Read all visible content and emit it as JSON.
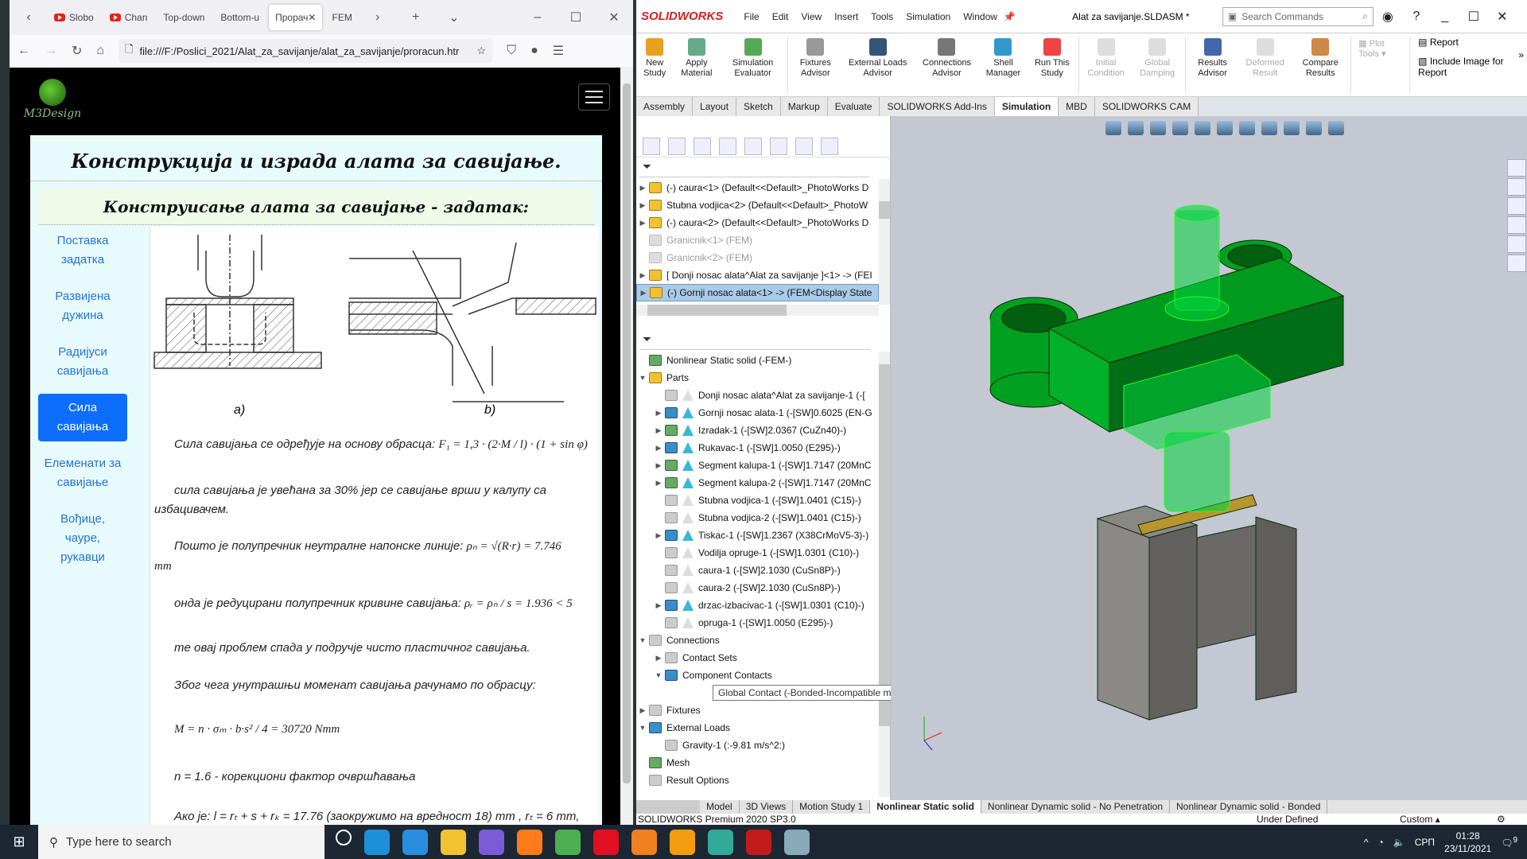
{
  "browser": {
    "tabs": [
      {
        "label": "Slobo",
        "icon": "youtube"
      },
      {
        "label": "Chan",
        "icon": "youtube"
      },
      {
        "label": "Top-down"
      },
      {
        "label": "Bottom-u"
      },
      {
        "label": "Прорач",
        "active": true
      },
      {
        "label": "FEM"
      }
    ],
    "url": "file:///F:/Poslici_2021/Alat_za_savijanje/alat_za_savijanje/proracun.htr",
    "site_logo": "M3Design",
    "page": {
      "title": "Конструкција и израда алата за савијање.",
      "subtitle": "Конструисање алата за савијање - задатак:",
      "nav": [
        "Поставка задатка",
        "Развијена дужина",
        "Радијуси савијања",
        "Сила савијања",
        "Елеменати за савијање",
        "Вођице, чауре, рукавци"
      ],
      "active_nav": 3,
      "figure_labels": {
        "a": "a)",
        "b": "b)"
      },
      "paragraphs": {
        "p1": "Сила савијања се одређује на основу обрасца:",
        "f1": "F₁ = 1,3 · (2·M / l) · (1 + sin φ)",
        "p2": "сила савијања је увећана за 30% јер се савијање врши у калупу са избацивачем.",
        "p3": "Пошто је полупречник неутралне напонске линије:",
        "f3": "ρₙ = √(R·r) =  7.746",
        "f3unit": "mm",
        "p4": "онда је редуцирани полупречник кривине савијања:",
        "f4": "ρᵣ = ρₙ / s =  1.936 < 5",
        "p5": "те овај проблем спада у подручје чисто пластичног савијања.",
        "p6": "Због чега унутрашњи моменат савијања рачунамо по обрасцу:",
        "f6": "M = n · σₘ · b·s² / 4 =  30720  Nmm",
        "p7": "n =  1.6 - корекциони фактор очвршћавања",
        "p8": "Ако је: l = rₜ + s + rₖ =  17.76 (заокружимо на вредност 18) mm , rₜ =  6 mm,"
      }
    }
  },
  "solidworks": {
    "brand": "SOLIDWORKS",
    "menu": [
      "File",
      "Edit",
      "View",
      "Insert",
      "Tools",
      "Simulation",
      "Window"
    ],
    "doc_title": "Alat za savijanje.SLDASM *",
    "search_placeholder": "Search Commands",
    "ribbon": [
      {
        "label": "New Study",
        "color": "#e8a020"
      },
      {
        "label": "Apply Material",
        "color": "#6a8"
      },
      {
        "label": "Simulation Evaluator",
        "color": "#5a5"
      },
      {
        "label": "Fixtures Advisor",
        "color": "#999"
      },
      {
        "label": "External Loads Advisor",
        "color": "#357"
      },
      {
        "label": "Connections Advisor",
        "color": "#777"
      },
      {
        "label": "Shell Manager",
        "color": "#39c"
      },
      {
        "label": "Run This Study",
        "color": "#e44"
      },
      {
        "label": "Initial Condition",
        "disabled": true
      },
      {
        "label": "Global Damping",
        "disabled": true
      },
      {
        "label": "Results Advisor",
        "color": "#46a"
      },
      {
        "label": "Deformed Result",
        "disabled": true
      },
      {
        "label": "Compare Results",
        "color": "#c84"
      }
    ],
    "ribbon_right": {
      "plot_tools": "Plot Tools",
      "report": "Report",
      "include_image": "Include Image for Report"
    },
    "command_tabs": [
      "Assembly",
      "Layout",
      "Sketch",
      "Markup",
      "Evaluate",
      "SOLIDWORKS Add-Ins",
      "Simulation",
      "MBD",
      "SOLIDWORKS CAM"
    ],
    "active_command_tab": "Simulation",
    "feature_tree": [
      {
        "label": "(-) caura<1> (Default<<Default>_PhotoWorks D"
      },
      {
        "label": "Stubna vodjica<2> (Default<<Default>_PhotoW"
      },
      {
        "label": "(-) caura<2> (Default<<Default>_PhotoWorks D"
      },
      {
        "label": "Granicnik<1> (FEM)",
        "dim": true
      },
      {
        "label": "Granicnik<2> (FEM)",
        "dim": true
      },
      {
        "label": "[ Donji nosac alata^Alat za savijanje ]<1> -> (FEI"
      },
      {
        "label": "(-) Gornji nosac alata<1> -> (FEM<Display State",
        "selected": true
      }
    ],
    "study": {
      "name": "Nonlinear Static solid (-FEM-)",
      "parts_label": "Parts",
      "parts": [
        {
          "label": "Donji nosac alata^Alat za savijanje-1 (-[",
          "active": false,
          "expand": false
        },
        {
          "label": "Gornji nosac alata-1 (-[SW]0.6025 (EN-G",
          "active": true,
          "expand": true
        },
        {
          "label": "Izradak-1 (-[SW]2.0367 (CuZn40)-)",
          "active": true,
          "expand": true,
          "mesh": true
        },
        {
          "label": "Rukavac-1 (-[SW]1.0050 (E295)-)",
          "active": true,
          "expand": true
        },
        {
          "label": "Segment kalupa-1 (-[SW]1.7147 (20MnC",
          "active": true,
          "expand": true,
          "mesh": true
        },
        {
          "label": "Segment kalupa-2 (-[SW]1.7147 (20MnC",
          "active": true,
          "expand": true,
          "mesh": true
        },
        {
          "label": "Stubna vodjica-1 (-[SW]1.0401 (C15)-)",
          "active": false,
          "expand": false
        },
        {
          "label": "Stubna vodjica-2 (-[SW]1.0401 (C15)-)",
          "active": false,
          "expand": false
        },
        {
          "label": "Tiskac-1 (-[SW]1.2367 (X38CrMoV5-3)-)",
          "active": true,
          "expand": true
        },
        {
          "label": "Vodilja opruge-1 (-[SW]1.0301 (C10)-)",
          "active": false,
          "expand": false
        },
        {
          "label": "caura-1 (-[SW]2.1030 (CuSn8P)-)",
          "active": false,
          "expand": false
        },
        {
          "label": "caura-2 (-[SW]2.1030 (CuSn8P)-)",
          "active": false,
          "expand": false
        },
        {
          "label": "drzac-izbacivac-1 (-[SW]1.0301 (C10)-)",
          "active": true,
          "expand": true
        },
        {
          "label": "opruga-1 (-[SW]1.0050 (E295)-)",
          "active": false,
          "expand": false
        }
      ],
      "connections": "Connections",
      "contact_sets": "Contact Sets",
      "component_contacts": "Component Contacts",
      "global_contact": "Global Contact (-Bonded-Incompatible mesh-)",
      "fixtures": "Fixtures",
      "external_loads": "External Loads",
      "gravity": "Gravity-1 (:-9.81 m/s^2:)",
      "mesh": "Mesh",
      "result_options": "Result Options"
    },
    "bottom_tabs": [
      "Model",
      "3D Views",
      "Motion Study 1",
      "Nonlinear Static solid",
      "Nonlinear Dynamic solid - No Penetration",
      "Nonlinear Dynamic solid - Bonded"
    ],
    "active_bottom_tab": "Nonlinear Static solid",
    "status": {
      "product": "SOLIDWORKS Premium 2020 SP3.0",
      "state": "Under Defined",
      "units": "Custom"
    },
    "colors": {
      "model_green": "#00a020",
      "die_gray": "#7a7875",
      "workpiece": "#b8962e",
      "viewport_bg": "#c3c8d2"
    }
  },
  "taskbar": {
    "search_placeholder": "Type here to search",
    "apps": [
      {
        "name": "task-view",
        "color": "#1c2733"
      },
      {
        "name": "edge",
        "color": "#1d8fd8"
      },
      {
        "name": "mail",
        "color": "#2a8ee0"
      },
      {
        "name": "file-explorer",
        "color": "#f2c230"
      },
      {
        "name": "viber",
        "color": "#7b5cd6"
      },
      {
        "name": "firefox",
        "color": "#ff7a1a"
      },
      {
        "name": "chrome",
        "color": "#4caf50"
      },
      {
        "name": "opera",
        "color": "#e01020"
      },
      {
        "name": "media-player",
        "color": "#f08020"
      },
      {
        "name": "sublime",
        "color": "#f39c12"
      },
      {
        "name": "git-kraken",
        "color": "#3a9"
      },
      {
        "name": "solidworks-2020",
        "color": "#c31a1a"
      },
      {
        "name": "paint",
        "color": "#8ab"
      }
    ],
    "language": "СРП",
    "time": "01:28",
    "date": "23/11/2021",
    "notifications": "9"
  }
}
